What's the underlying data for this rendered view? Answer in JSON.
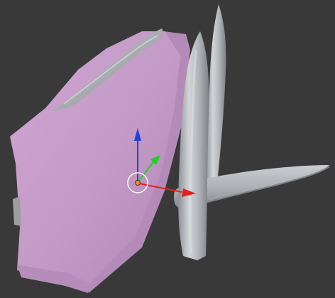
{
  "viewport": {
    "background": "#393939"
  },
  "scene": {
    "objects": [
      {
        "name": "pink-block",
        "color": "#c69bc8"
      },
      {
        "name": "blade-large",
        "color": "#a9adb1"
      },
      {
        "name": "blade-mid",
        "color": "#b4b8bc"
      },
      {
        "name": "blade-lying",
        "color": "#b0b4b8"
      },
      {
        "name": "blade-back",
        "color": "#9ea2a6"
      }
    ]
  },
  "gizmo": {
    "x_axis_color": "#e02020",
    "y_axis_color": "#20d020",
    "z_axis_color": "#2040e0",
    "pivot_color": "#f08a30"
  }
}
